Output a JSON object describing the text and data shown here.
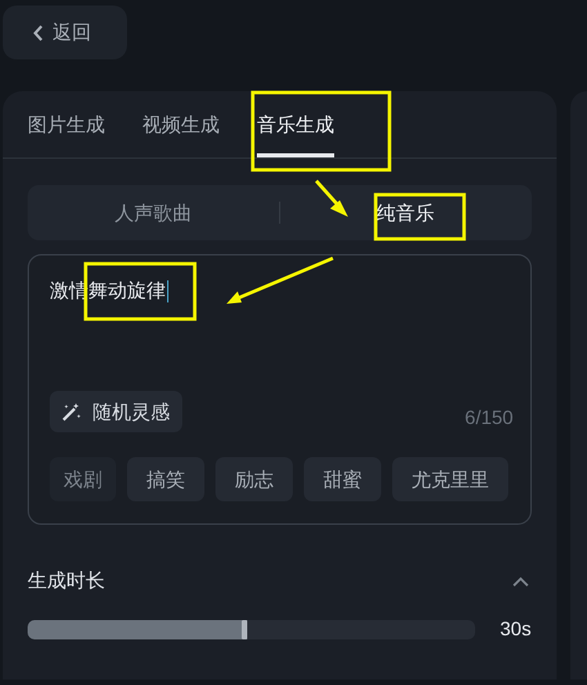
{
  "back_button": {
    "label": "返回"
  },
  "tabs": [
    {
      "label": "图片生成",
      "selected": false
    },
    {
      "label": "视频生成",
      "selected": false
    },
    {
      "label": "音乐生成",
      "selected": true
    }
  ],
  "mode_switch": [
    {
      "label": "人声歌曲",
      "selected": false
    },
    {
      "label": "纯音乐",
      "selected": true
    }
  ],
  "prompt": {
    "value": "激情舞动旋律",
    "counter": "6/150"
  },
  "inspiration_button": {
    "label": "随机灵感"
  },
  "style_chips": [
    {
      "label": "戏剧"
    },
    {
      "label": "搞笑"
    },
    {
      "label": "励志"
    },
    {
      "label": "甜蜜"
    },
    {
      "label": "尤克里里"
    }
  ],
  "duration": {
    "title": "生成时长",
    "expanded": true,
    "level": 0.49,
    "reading": "30s"
  }
}
